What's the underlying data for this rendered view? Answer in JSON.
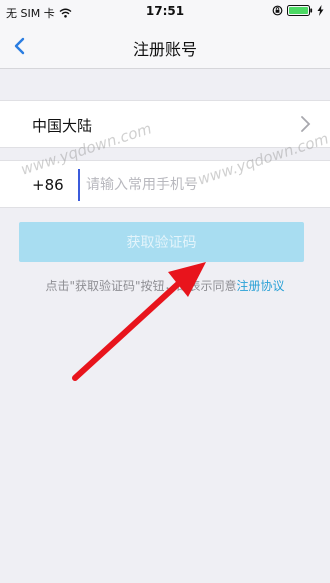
{
  "status_bar": {
    "carrier": "无 SIM 卡",
    "time": "17:51"
  },
  "nav": {
    "title": "注册账号"
  },
  "region": {
    "label": "中国大陆"
  },
  "phone": {
    "country_code": "+86",
    "placeholder": "请输入常用手机号"
  },
  "get_code_button": {
    "label": "获取验证码"
  },
  "tip": {
    "prefix": "点击\"获取验证码\"按钮，即表示同意",
    "link_text": "注册协议"
  },
  "watermarks": [
    "www.yqdown.com",
    "www.yqdown.com"
  ],
  "colors": {
    "button_bg": "#a8ddf1",
    "link": "#2aa1d6",
    "arrow": "#e8141c",
    "nav_accent": "#2a7de1"
  }
}
